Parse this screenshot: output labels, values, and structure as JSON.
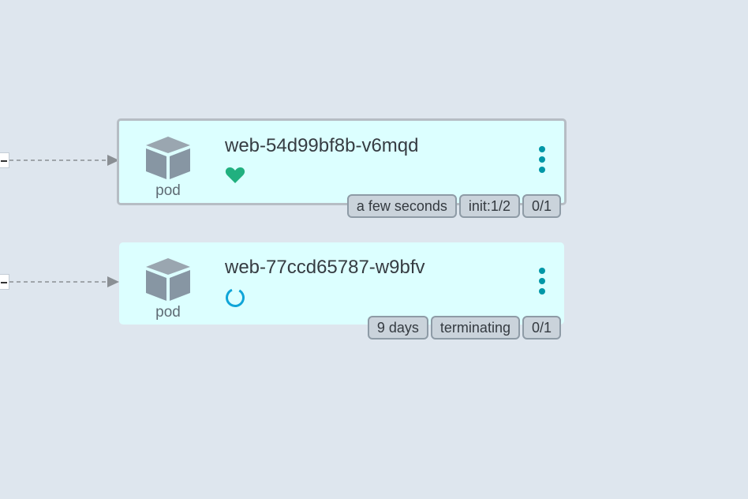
{
  "nodes": [
    {
      "kind": "pod",
      "name": "web-54d99bf8b-v6mqd",
      "status_icon": "heart-icon",
      "status_color": "#21b07f",
      "selected": true,
      "tags": [
        "a few seconds",
        "init:1/2",
        "0/1"
      ]
    },
    {
      "kind": "pod",
      "name": "web-77ccd65787-w9bfv",
      "status_icon": "progressing-spinner-icon",
      "status_color": "#10a5d8",
      "selected": false,
      "tags": [
        "9 days",
        "terminating",
        "0/1"
      ]
    }
  ],
  "colors": {
    "background": "#dee6ee",
    "node_background": "#dcffff",
    "menu_accent": "#0097a7",
    "icon_gray": "#8796a3"
  }
}
